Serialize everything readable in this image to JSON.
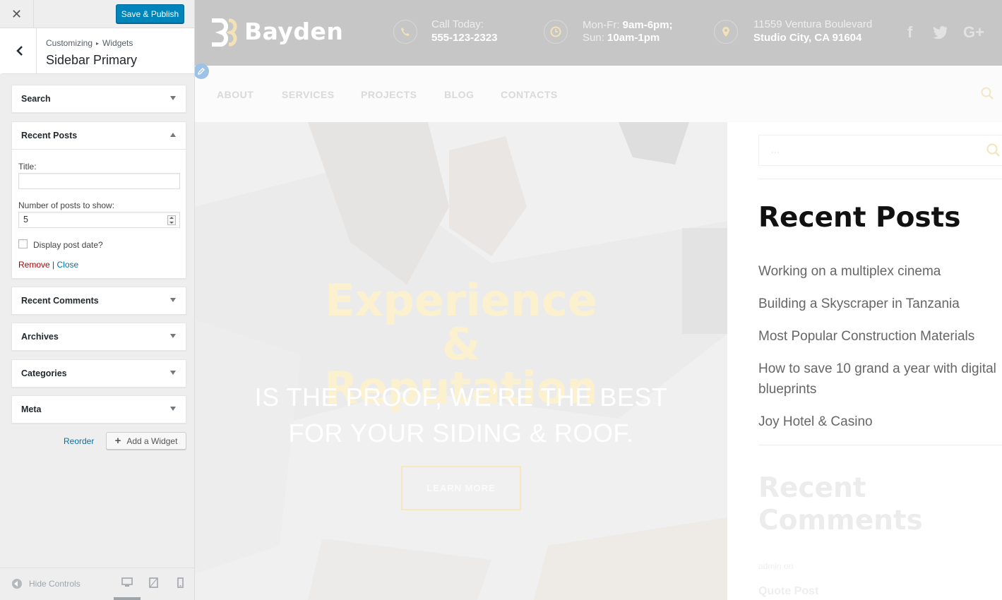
{
  "customizer": {
    "close_label": "✕",
    "save_button": "Save & Publish",
    "breadcrumb": {
      "root": "Customizing",
      "separator": "▸",
      "section": "Widgets"
    },
    "section_title": "Sidebar Primary",
    "widgets": [
      {
        "title": "Search",
        "expanded": false
      },
      {
        "title": "Recent Posts",
        "expanded": true
      },
      {
        "title": "Recent Comments",
        "expanded": false
      },
      {
        "title": "Archives",
        "expanded": false
      },
      {
        "title": "Categories",
        "expanded": false
      },
      {
        "title": "Meta",
        "expanded": false
      }
    ],
    "recent_posts_form": {
      "title_label": "Title:",
      "title_value": "",
      "number_label": "Number of posts to show:",
      "number_value": "5",
      "display_date_label": "Display post date?",
      "display_date_checked": false,
      "remove_link": "Remove",
      "link_separator": "|",
      "close_link": "Close"
    },
    "reorder_link": "Reorder",
    "add_widget_button": "Add a Widget",
    "add_widget_icon": "plus-icon",
    "hide_controls": "Hide Controls",
    "devices": [
      "desktop-icon",
      "tablet-icon",
      "mobile-icon"
    ],
    "active_device": "desktop"
  },
  "site": {
    "logo_text": "Bayden",
    "contact": {
      "call_label": "Call Today:",
      "call_number": "555-123-2323",
      "hours_weekday_label": "Mon-Fr:",
      "hours_weekday": "9am-6pm;",
      "hours_sunday_label": "Sun:",
      "hours_sunday": "10am-1pm",
      "address_line1": "11559 Ventura Boulevard",
      "address_line2": "Studio City, CA 91604"
    },
    "social": [
      "f",
      "twitter-icon",
      "G+"
    ],
    "nav": [
      "ABOUT",
      "SERVICES",
      "PROJECTS",
      "BLOG",
      "CONTACTS"
    ],
    "hero": {
      "title": "Experience & Reputation",
      "subtitle": "IS THE PROOF, WE’RE THE BEST FOR YOUR SIDING & ROOF.",
      "button": "LEARN MORE"
    },
    "sidebar": {
      "search_placeholder": "…",
      "recent_posts_title": "Recent Posts",
      "recent_posts": [
        "Working on a multiplex cinema",
        "Building a Skyscraper in Tanzania",
        "Most Popular Construction Materials",
        "How to save 10 grand a year with digital blueprints",
        "Joy Hotel & Casino"
      ],
      "recent_comments_title": "Recent Comments",
      "comment_meta": "admin on",
      "comment_post": "Quote Post"
    }
  },
  "colors": {
    "wp_blue": "#0085ba",
    "link_blue": "#0073aa",
    "remove_red": "#aa0000",
    "header_gray": "#c6c6c6",
    "accent_gold": "#f3e2b8"
  }
}
